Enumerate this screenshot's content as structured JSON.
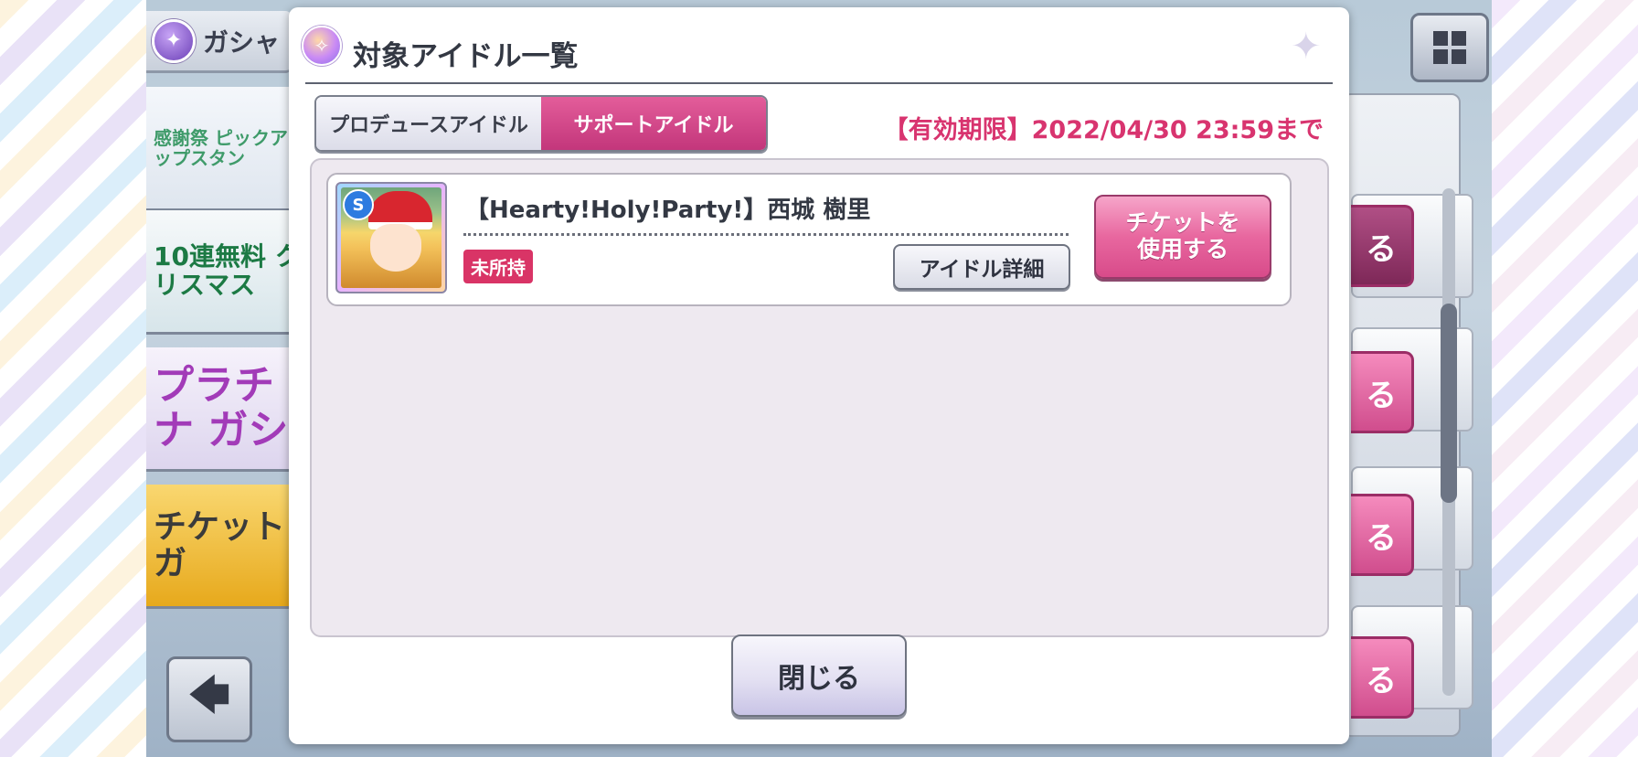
{
  "game": {
    "header_title": "ガシャ",
    "banners": [
      {
        "label": "感謝祭 ピックアップスタン"
      },
      {
        "label": "10連無料 クリスマス"
      },
      {
        "label": "プラチナ ガシ"
      },
      {
        "label": "チケットガ"
      }
    ],
    "right_buttons": [
      "る",
      "る",
      "る",
      "る"
    ]
  },
  "modal": {
    "title": "対象アイドル一覧",
    "tabs": [
      {
        "label": "プロデュースアイドル",
        "active": false
      },
      {
        "label": "サポートアイドル",
        "active": true
      }
    ],
    "expiry": "【有効期限】2022/04/30 23:59まで",
    "items": [
      {
        "name": "【Hearty!Holy!Party!】西城 樹里",
        "attr_icon": "S",
        "status_badge": "未所持",
        "detail_button": "アイドル詳細",
        "use_button_line1": "チケットを",
        "use_button_line2": "使用する"
      }
    ],
    "close_button": "閉じる"
  },
  "colors": {
    "accent_pink": "#d8346f",
    "tab_active": "#c3367b",
    "badge": "#d93466"
  }
}
